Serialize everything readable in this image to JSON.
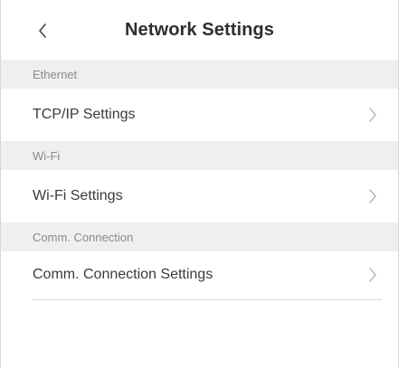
{
  "header": {
    "title": "Network Settings",
    "back_icon": "chevron-left-icon"
  },
  "sections": [
    {
      "label": "Ethernet",
      "item": {
        "label": "TCP/IP Settings",
        "icon": "chevron-right-icon"
      }
    },
    {
      "label": "Wi-Fi",
      "item": {
        "label": "Wi-Fi Settings",
        "icon": "chevron-right-icon"
      }
    },
    {
      "label": "Comm. Connection",
      "item": {
        "label": "Comm. Connection Settings",
        "icon": "chevron-right-icon"
      }
    }
  ],
  "colors": {
    "section_bg": "#efefef",
    "section_text": "#8a8a8a",
    "divider": "#d9d9d9"
  }
}
